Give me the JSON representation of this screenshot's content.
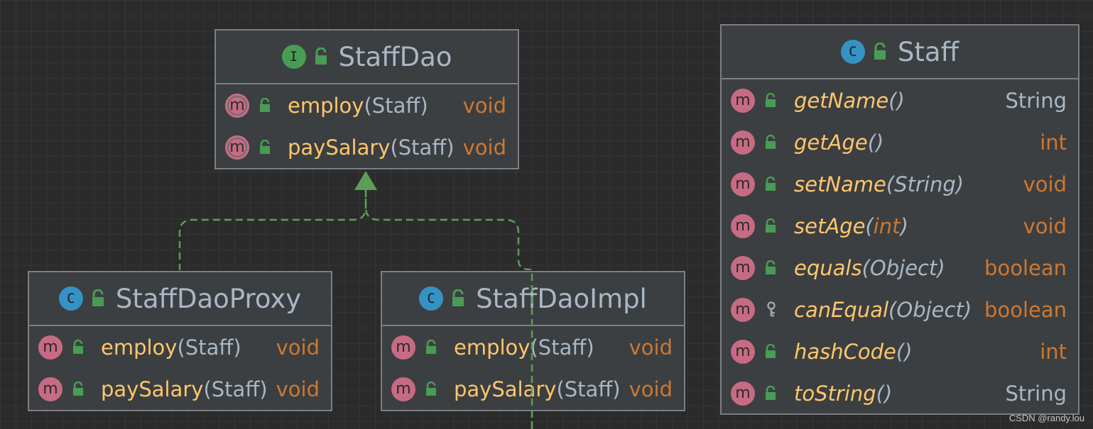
{
  "diagram": {
    "colors": {
      "background": "#2b2b2b",
      "box": "#3c3f41",
      "border": "#7d7f82",
      "method_name": "#ffc66d",
      "keyword": "#cc7832",
      "text": "#a9b7c6",
      "interface_icon": "#499c54",
      "class_icon": "#3592c4",
      "method_icon": "#c76b84",
      "relation_line": "#5a9e57"
    },
    "nodes": [
      {
        "id": "staffdao",
        "kind": "interface",
        "kind_letter": "I",
        "kind_icon": "interface-icon",
        "name": "StaffDao",
        "members": [
          {
            "name": "employ",
            "open": "(",
            "params": "Staff",
            "close": ")",
            "returns": "void",
            "visibility": "public",
            "abstract": true
          },
          {
            "name": "paySalary",
            "open": "(",
            "params": "Staff",
            "close": ")",
            "returns": "void",
            "visibility": "public",
            "abstract": true
          }
        ]
      },
      {
        "id": "staffdaoproxy",
        "kind": "class",
        "kind_letter": "C",
        "kind_icon": "class-icon",
        "name": "StaffDaoProxy",
        "members": [
          {
            "name": "employ",
            "open": "(",
            "params": "Staff",
            "close": ")",
            "returns": "void",
            "visibility": "public"
          },
          {
            "name": "paySalary",
            "open": "(",
            "params": "Staff",
            "close": ")",
            "returns": "void",
            "visibility": "public"
          }
        ]
      },
      {
        "id": "staffdaoimpl",
        "kind": "class",
        "kind_letter": "C",
        "kind_icon": "class-icon",
        "name": "StaffDaoImpl",
        "members": [
          {
            "name": "employ",
            "open": "(",
            "params": "Staff",
            "close": ")",
            "returns": "void",
            "visibility": "public"
          },
          {
            "name": "paySalary",
            "open": "(",
            "params": "Staff",
            "close": ")",
            "returns": "void",
            "visibility": "public"
          }
        ]
      },
      {
        "id": "staff",
        "kind": "class",
        "kind_letter": "C",
        "kind_icon": "class-icon",
        "name": "Staff",
        "members": [
          {
            "name": "getName",
            "open": "(",
            "params": "",
            "close": ")",
            "returns": "String",
            "visibility": "public"
          },
          {
            "name": "getAge",
            "open": "(",
            "params": "",
            "close": ")",
            "returns": "int",
            "visibility": "public"
          },
          {
            "name": "setName",
            "open": "(",
            "params": "String",
            "close": ")",
            "returns": "void",
            "visibility": "public"
          },
          {
            "name": "setAge",
            "open": "(",
            "params": "int",
            "close": ")",
            "returns": "void",
            "visibility": "public"
          },
          {
            "name": "equals",
            "open": "(",
            "params": "Object",
            "close": ")",
            "returns": "boolean",
            "visibility": "public"
          },
          {
            "name": "canEqual",
            "open": "(",
            "params": "Object",
            "close": ")",
            "returns": "boolean",
            "visibility": "protected"
          },
          {
            "name": "hashCode",
            "open": "(",
            "params": "",
            "close": ")",
            "returns": "int",
            "visibility": "public"
          },
          {
            "name": "toString",
            "open": "(",
            "params": "",
            "close": ")",
            "returns": "String",
            "visibility": "public"
          }
        ]
      }
    ],
    "edges": [
      {
        "from": "staffdaoproxy",
        "to": "staffdao",
        "type": "realization"
      },
      {
        "from": "staffdaoimpl",
        "to": "staffdao",
        "type": "realization"
      }
    ]
  },
  "watermark": "CSDN @randy.lou"
}
